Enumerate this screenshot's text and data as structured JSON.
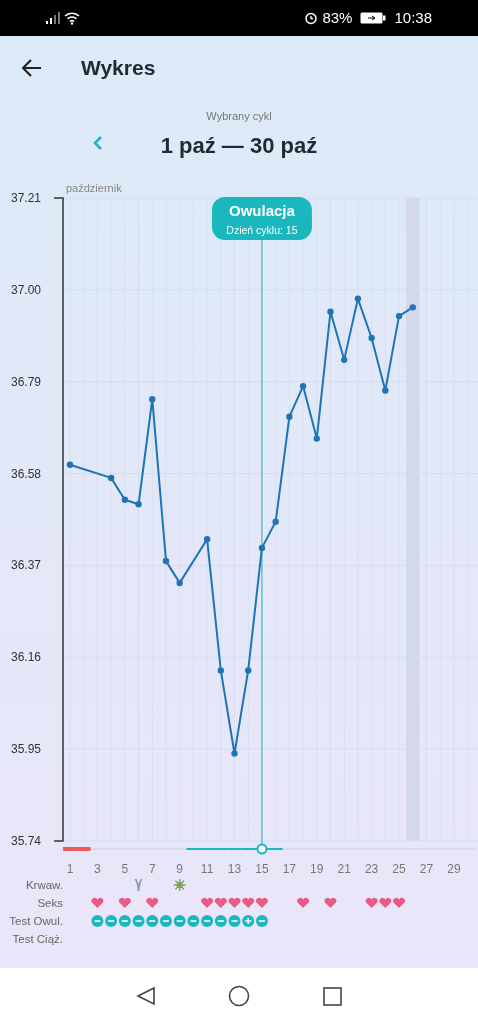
{
  "status_bar": {
    "battery": "83%",
    "time": "10:38"
  },
  "header": {
    "title": "Wykres"
  },
  "cycle": {
    "caption": "Wybrany cykl",
    "range": "1 paź — 30 paź"
  },
  "month_label": "październik",
  "chart_data": {
    "type": "line",
    "x": [
      1,
      2,
      3,
      4,
      5,
      6,
      7,
      8,
      9,
      10,
      11,
      12,
      13,
      14,
      15,
      16,
      17,
      18,
      19,
      20,
      21,
      22,
      23,
      24,
      25,
      26
    ],
    "xlim": [
      1,
      30
    ],
    "grid": true,
    "series": [
      {
        "color": "#1f74b6",
        "marker": "o",
        "values": [
          36.6,
          null,
          null,
          36.57,
          36.52,
          36.51,
          36.75,
          36.38,
          36.33,
          null,
          36.43,
          36.13,
          35.94,
          36.13,
          36.41,
          36.47,
          36.71,
          36.78,
          36.66,
          36.95,
          36.84,
          36.98,
          36.89,
          36.77,
          36.94,
          36.96
        ]
      }
    ],
    "ylim": [
      35.74,
      37.21
    ],
    "yticks": [
      {
        "value": 35.74,
        "label": "35.74"
      },
      {
        "value": 35.95,
        "label": "35.95"
      },
      {
        "value": 36.16,
        "label": "36.16"
      },
      {
        "value": 36.37,
        "label": "36.37"
      },
      {
        "value": 36.58,
        "label": "36.58"
      },
      {
        "value": 36.79,
        "label": "36.79"
      },
      {
        "value": 37.0,
        "label": "37.00"
      },
      {
        "value": 37.21,
        "label": "37.21"
      }
    ],
    "xticks": [
      1,
      3,
      5,
      7,
      9,
      11,
      13,
      15,
      17,
      19,
      21,
      23,
      25,
      27,
      29
    ],
    "ref_lines": [
      {
        "axis": "x",
        "value": 15,
        "color": "#1ab8be"
      }
    ],
    "bands": [
      {
        "axis": "x",
        "from": 25.5,
        "to": 26.5,
        "color": "#d3d9e8"
      }
    ]
  },
  "ovulation": {
    "label": "Owulacja",
    "text": "Dzień cyklu: 15"
  },
  "cycle_days": [
    {
      "kind": "period"
    },
    {
      "kind": "period"
    },
    {
      "kind": "none"
    },
    {
      "kind": "none"
    },
    {
      "kind": "none"
    },
    {
      "kind": "none"
    },
    {
      "kind": "none"
    },
    {
      "kind": "none"
    },
    {
      "kind": "none"
    },
    {
      "kind": "fertile"
    },
    {
      "kind": "fertile"
    },
    {
      "kind": "fertile"
    },
    {
      "kind": "fertile"
    },
    {
      "kind": "fertile"
    },
    {
      "kind": "fertile"
    },
    {
      "kind": "fertile"
    },
    {
      "kind": "none"
    },
    {
      "kind": "none"
    },
    {
      "kind": "none"
    },
    {
      "kind": "none"
    },
    {
      "kind": "none"
    },
    {
      "kind": "none"
    },
    {
      "kind": "none"
    },
    {
      "kind": "none"
    },
    {
      "kind": "none"
    },
    {
      "kind": "none"
    },
    {
      "kind": "none"
    },
    {
      "kind": "none"
    },
    {
      "kind": "none"
    },
    {
      "kind": "none"
    }
  ],
  "rows": [
    {
      "label": "Krwaw.",
      "days": [
        {
          "kind": "none"
        },
        {
          "kind": "none"
        },
        {
          "kind": "none"
        },
        {
          "kind": "none"
        },
        {
          "kind": "none"
        },
        {
          "kind": "spot"
        },
        {
          "kind": "none"
        },
        {
          "kind": "none"
        },
        {
          "kind": "burst"
        }
      ]
    },
    {
      "label": "Seks",
      "days": [
        {
          "kind": "none"
        },
        {
          "kind": "none"
        },
        {
          "kind": "heart"
        },
        {
          "kind": "none"
        },
        {
          "kind": "heart"
        },
        {
          "kind": "none"
        },
        {
          "kind": "heart"
        },
        {
          "kind": "none"
        },
        {
          "kind": "none"
        },
        {
          "kind": "none"
        },
        {
          "kind": "heart"
        },
        {
          "kind": "heart"
        },
        {
          "kind": "heart"
        },
        {
          "kind": "heart"
        },
        {
          "kind": "heart"
        },
        {
          "kind": "none"
        },
        {
          "kind": "none"
        },
        {
          "kind": "heart"
        },
        {
          "kind": "none"
        },
        {
          "kind": "heart"
        },
        {
          "kind": "none"
        },
        {
          "kind": "none"
        },
        {
          "kind": "heart"
        },
        {
          "kind": "heart"
        },
        {
          "kind": "heart"
        }
      ]
    },
    {
      "label": "Test Owul.",
      "days": [
        {
          "kind": "none"
        },
        {
          "kind": "none"
        },
        {
          "kind": "negative"
        },
        {
          "kind": "negative"
        },
        {
          "kind": "negative"
        },
        {
          "kind": "negative"
        },
        {
          "kind": "negative"
        },
        {
          "kind": "negative"
        },
        {
          "kind": "negative"
        },
        {
          "kind": "negative"
        },
        {
          "kind": "negative"
        },
        {
          "kind": "negative"
        },
        {
          "kind": "negative"
        },
        {
          "kind": "positive"
        },
        {
          "kind": "negative"
        }
      ]
    },
    {
      "label": "Test Ciąż."
    }
  ]
}
